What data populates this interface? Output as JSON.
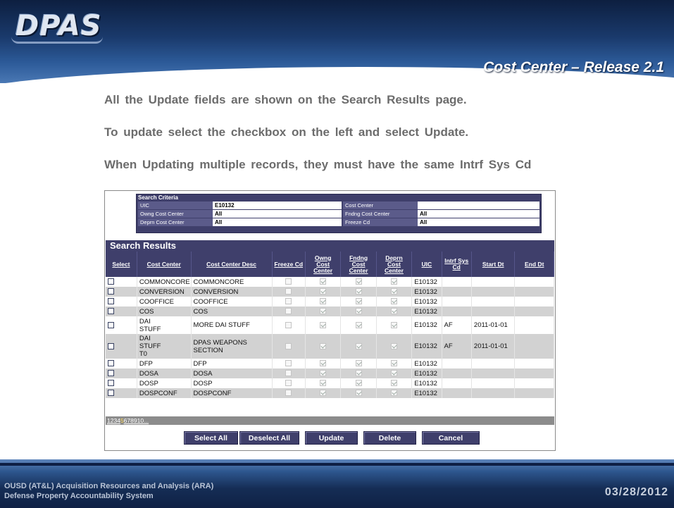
{
  "slide": {
    "logo": "DPAS",
    "title": "Cost Center – Release 2.1",
    "bullets": [
      "All the Update fields are shown on the Search Results page.",
      "To update select the checkbox on the left and select Update.",
      "When Updating multiple records, they must have the same Intrf Sys Cd"
    ]
  },
  "search_criteria": {
    "title": "Search Criteria",
    "rows": [
      {
        "label": "UIC",
        "value": "E10132",
        "label2": "Cost Center",
        "value2": ""
      },
      {
        "label": "Owng Cost Center",
        "value": "All",
        "label2": "Fndng Cost Center",
        "value2": "All"
      },
      {
        "label": "Deprn Cost Center",
        "value": "All",
        "label2": "Freeze Cd",
        "value2": "All"
      }
    ]
  },
  "results": {
    "title": "Search Results",
    "columns": {
      "select": "Select",
      "cost_center": "Cost Center",
      "desc": "Cost Center Desc",
      "freeze": "Freeze Cd",
      "owng1": "Owng",
      "owng2": "Cost",
      "owng3": "Center",
      "fndng1": "Fndng",
      "fndng2": "Cost",
      "fndng3": "Center",
      "deprn1": "Deprn",
      "deprn2": "Cost",
      "deprn3": "Center",
      "uic": "UIC",
      "intrf1": "Intrf Sys",
      "intrf2": "Cd",
      "start": "Start Dt",
      "end": "End Dt"
    },
    "rows": [
      {
        "cost_center": "COMMONCORE",
        "desc": "COMMONCORE",
        "uic": "E10132",
        "intrf": "",
        "start": "",
        "end": ""
      },
      {
        "cost_center": "CONVERSION",
        "desc": "CONVERSION",
        "uic": "E10132",
        "intrf": "",
        "start": "",
        "end": ""
      },
      {
        "cost_center": "COOFFICE",
        "desc": "COOFFICE",
        "uic": "E10132",
        "intrf": "",
        "start": "",
        "end": ""
      },
      {
        "cost_center": "COS",
        "desc": "COS",
        "uic": "E10132",
        "intrf": "",
        "start": "",
        "end": ""
      },
      {
        "cost_center": "DAI STUFF",
        "cc_line1": "DAI",
        "cc_line2": "STUFF",
        "desc": "MORE DAI STUFF",
        "uic": "E10132",
        "intrf": "AF",
        "start": "2011-01-01",
        "end": ""
      },
      {
        "cost_center": "DAI STUFF T0",
        "cc_line1": "DAI",
        "cc_line2": "STUFF",
        "cc_line3": "T0",
        "desc": "DPAS WEAPONS SECTION",
        "uic": "E10132",
        "intrf": "AF",
        "start": "2011-01-01",
        "end": ""
      },
      {
        "cost_center": "DFP",
        "desc": "DFP",
        "uic": "E10132",
        "intrf": "",
        "start": "",
        "end": ""
      },
      {
        "cost_center": "DOSA",
        "desc": "DOSA",
        "uic": "E10132",
        "intrf": "",
        "start": "",
        "end": ""
      },
      {
        "cost_center": "DOSP",
        "desc": "DOSP",
        "uic": "E10132",
        "intrf": "",
        "start": "",
        "end": ""
      },
      {
        "cost_center": "DOSPCONF",
        "desc": "DOSPCONF",
        "uic": "E10132",
        "intrf": "",
        "start": "",
        "end": ""
      }
    ],
    "pager": [
      "1",
      "2",
      "3",
      "4",
      "5",
      "6",
      "7",
      "8",
      "9",
      "10",
      "..."
    ],
    "current_page": "5"
  },
  "buttons": {
    "select_all": "Select All",
    "deselect_all": "Deselect All",
    "update": "Update",
    "delete": "Delete",
    "cancel": "Cancel"
  },
  "footer": {
    "line1": "OUSD (AT&L) Acquisition Resources and Analysis (ARA)",
    "line2": "Defense Property Accountability System",
    "date": "03/28/2012"
  }
}
